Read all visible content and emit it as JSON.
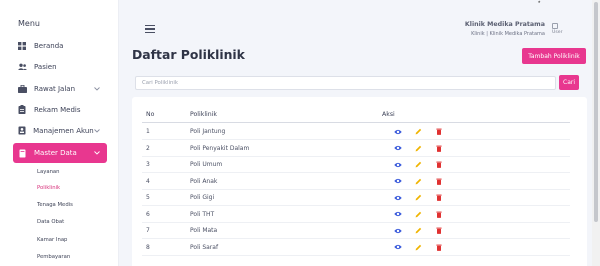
{
  "sidebar": {
    "title": "Menu",
    "items": [
      {
        "label": "Beranda",
        "icon": "dashboard-icon"
      },
      {
        "label": "Pasien",
        "icon": "users-icon"
      },
      {
        "label": "Rawat Jalan",
        "icon": "briefcase-icon"
      },
      {
        "label": "Rekam Medis",
        "icon": "clipboard-icon"
      },
      {
        "label": "Manajemen Akun",
        "icon": "id-card-icon"
      },
      {
        "label": "Master Data",
        "icon": "book-icon"
      }
    ],
    "sub_items": [
      "Layanan",
      "Poliklinik",
      "Tenaga Medis",
      "Data Obat",
      "Kamar Inap",
      "Pembayaran"
    ],
    "active_sub": "Poliklinik"
  },
  "header": {
    "clinic_name": "Klinik Medika Pratama",
    "clinic_sub": "Klinik | Klinik Medika Pratama",
    "avatar_alt": "User"
  },
  "page": {
    "title": "Daftar Poliklinik",
    "add_button": "Tambah Poliklinik",
    "search_placeholder": "Cari Poliklinik",
    "search_button": "Cari"
  },
  "table": {
    "columns": [
      "No",
      "Poliklinik",
      "Aksi"
    ],
    "rows": [
      {
        "no": "1",
        "name": "Poli Jantung"
      },
      {
        "no": "2",
        "name": "Poli Penyakit Dalam"
      },
      {
        "no": "3",
        "name": "Poli Umum"
      },
      {
        "no": "4",
        "name": "Poli Anak"
      },
      {
        "no": "5",
        "name": "Poli Gigi"
      },
      {
        "no": "6",
        "name": "Poli THT"
      },
      {
        "no": "7",
        "name": "Poli Mata"
      },
      {
        "no": "8",
        "name": "Poli Saraf"
      }
    ]
  },
  "colors": {
    "accent": "#e8378f",
    "view_icon": "#3b5bdb",
    "edit_icon": "#f0b400",
    "delete_icon": "#e03131"
  }
}
